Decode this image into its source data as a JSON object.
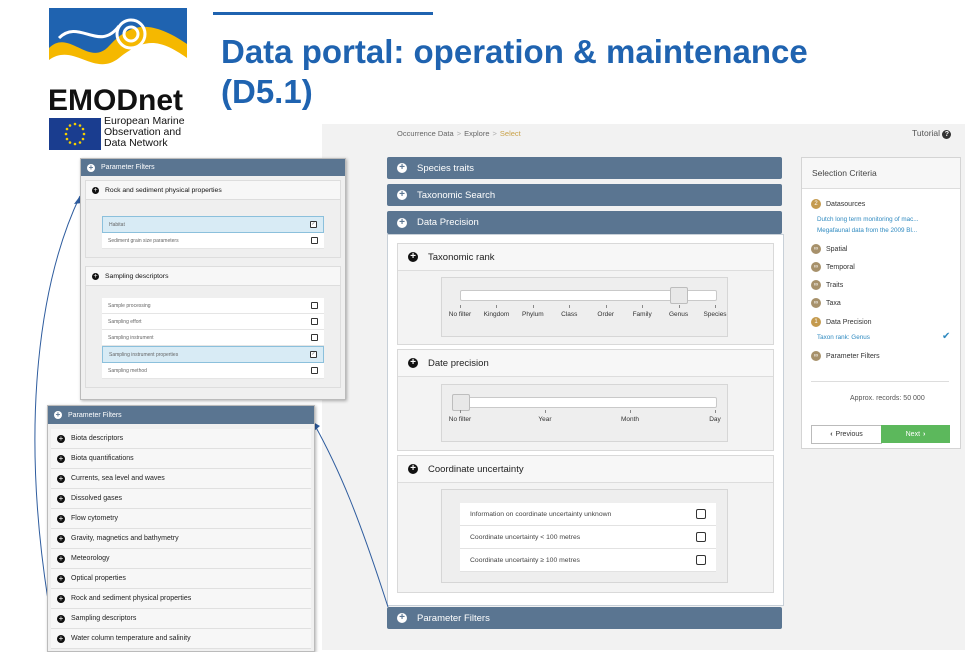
{
  "header": {
    "title_line1": "Data portal: operation & maintenance",
    "title_line2": "(D5.1)",
    "logo_text": "EMODnet",
    "eu_text_1": "European Marine",
    "eu_text_2": "Observation and",
    "eu_text_3": "Data Network"
  },
  "colors": {
    "brand_blue": "#1f63b0",
    "panel_header": "#5a7591",
    "next_green": "#5cb85c",
    "link_blue": "#2f8ac0"
  },
  "breadcrumb": {
    "item1": "Occurrence Data",
    "item2": "Explore",
    "item3": "Select",
    "sep": ">"
  },
  "tutorial": {
    "label": "Tutorial",
    "icon": "?"
  },
  "panels": {
    "species_traits": "Species traits",
    "taxonomic_search": "Taxonomic Search",
    "data_precision": "Data Precision",
    "parameter_filters": "Parameter Filters"
  },
  "taxonomic_rank": {
    "title": "Taxonomic rank",
    "ticks": [
      "No filter",
      "Kingdom",
      "Phylum",
      "Class",
      "Order",
      "Family",
      "Genus",
      "Species"
    ],
    "selected_index": 6
  },
  "date_precision": {
    "title": "Date precision",
    "ticks": [
      "No filter",
      "Year",
      "Month",
      "Day"
    ],
    "selected_index": 0
  },
  "coordinate_uncertainty": {
    "title": "Coordinate uncertainty",
    "options": [
      "Information on coordinate uncertainty unknown",
      "Coordinate uncertainty < 100 metres",
      "Coordinate uncertainty ≥ 100 metres"
    ]
  },
  "selection": {
    "title": "Selection Criteria",
    "datasources_count": "2",
    "datasources_label": "Datasources",
    "ds1": "Dutch long term monitoring of mac...",
    "ds2": "Megafaunal data from the 2009 Bl...",
    "spatial": "Spatial",
    "temporal": "Temporal",
    "traits": "Traits",
    "taxa": "Taxa",
    "precision_count": "1",
    "precision_label": "Data Precision",
    "taxon_rank": "Taxon rank: Genus",
    "param_filters": "Parameter Filters",
    "approx": "Approx. records:  50 000",
    "prev": "Previous",
    "next": "Next"
  },
  "shot1": {
    "header": "Parameter Filters",
    "group1": "Rock and sediment physical properties",
    "group1_items": [
      "Habitat",
      "Sediment grain size parameters"
    ],
    "group1_checked": [
      true,
      false
    ],
    "group2": "Sampling descriptors",
    "group2_items": [
      "Sample processing",
      "Sampling effort",
      "Sampling instrument",
      "Sampling instrument properties",
      "Sampling method"
    ],
    "group2_checked": [
      false,
      false,
      false,
      true,
      false
    ]
  },
  "shot2": {
    "header": "Parameter Filters",
    "items": [
      "Biota descriptors",
      "Biota quantifications",
      "Currents, sea level and waves",
      "Dissolved gases",
      "Flow cytometry",
      "Gravity, magnetics and bathymetry",
      "Meteorology",
      "Optical properties",
      "Rock and sediment physical properties",
      "Sampling descriptors",
      "Water column temperature and salinity"
    ]
  }
}
